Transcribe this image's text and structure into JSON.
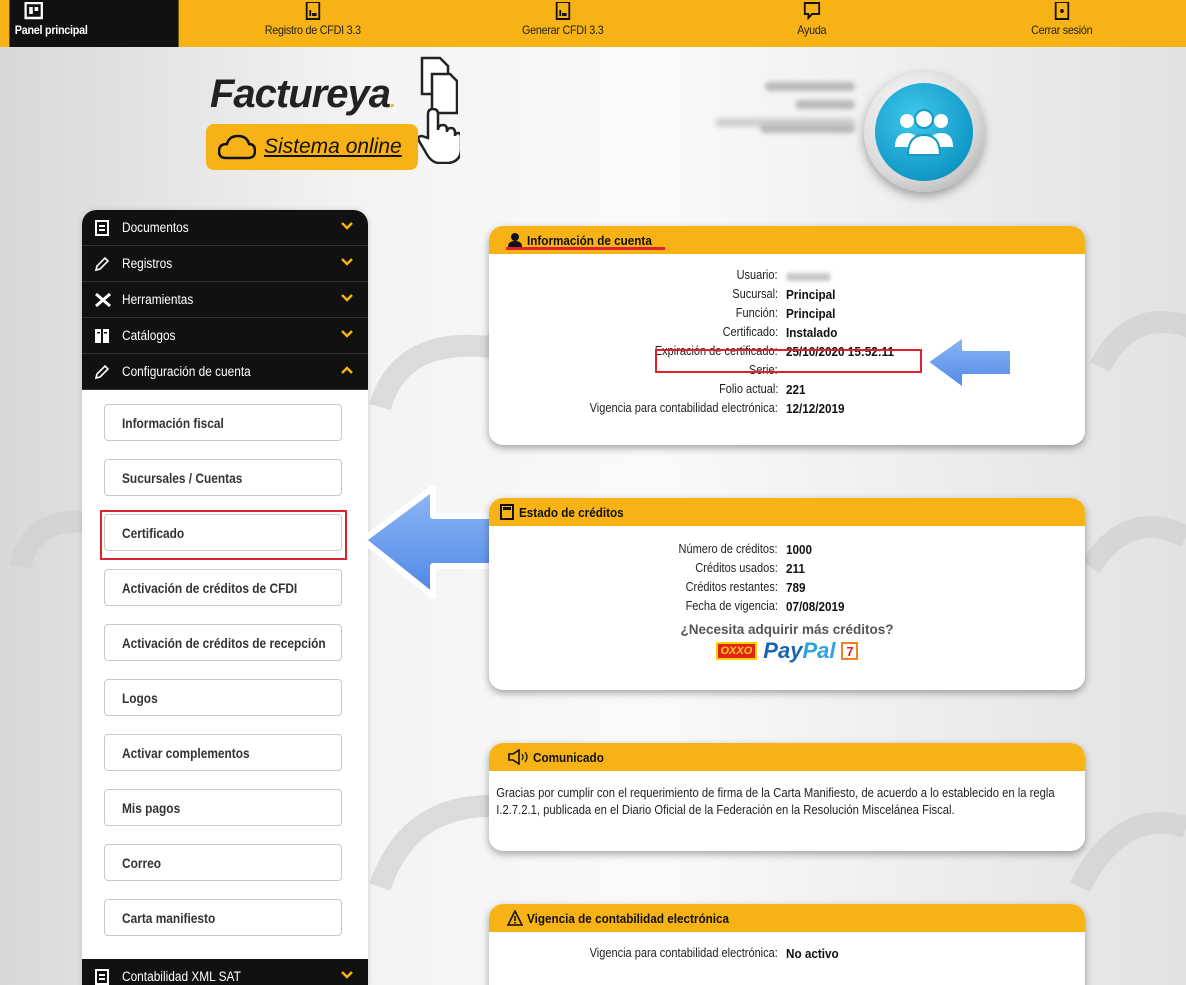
{
  "nav": {
    "items": [
      {
        "label": "Panel principal",
        "icon": "dashboard-icon"
      },
      {
        "label": "Registro de CFDI 3.3",
        "icon": "document-chart-icon"
      },
      {
        "label": "Generar CFDI 3.3",
        "icon": "document-chart-icon"
      },
      {
        "label": "Ayuda",
        "icon": "chat-bubble-icon"
      },
      {
        "label": "Cerrar sesión",
        "icon": "logout-icon"
      }
    ]
  },
  "logo": {
    "brand": "Factureya",
    "dot": ".",
    "tagline": "Sistema online"
  },
  "sidebar": {
    "sections": [
      {
        "label": "Documentos",
        "icon": "document-icon"
      },
      {
        "label": "Registros",
        "icon": "pencil-icon"
      },
      {
        "label": "Herramientas",
        "icon": "tools-icon"
      },
      {
        "label": "Catálogos",
        "icon": "book-icon"
      },
      {
        "label": "Configuración de cuenta",
        "icon": "pencil-icon"
      }
    ],
    "sub_items": [
      "Información fiscal",
      "Sucursales / Cuentas",
      "Certificado",
      "Activación de créditos de CFDI",
      "Activación de créditos de recepción",
      "Logos",
      "Activar complementos",
      "Mis pagos",
      "Correo",
      "Carta manifiesto"
    ],
    "last_section": {
      "label": "Contabilidad XML SAT",
      "icon": "document-icon"
    }
  },
  "account": {
    "title": "Información de cuenta",
    "rows": [
      {
        "k": "Usuario:",
        "v": ""
      },
      {
        "k": "Sucursal:",
        "v": "Principal"
      },
      {
        "k": "Función:",
        "v": "Principal"
      },
      {
        "k": "Certificado:",
        "v": "Instalado"
      },
      {
        "k": "Expiración de certificado:",
        "v": "25/10/2020 15:52:11"
      },
      {
        "k": "Serie:",
        "v": "-"
      },
      {
        "k": "Folio actual:",
        "v": "221"
      },
      {
        "k": "Vigencia para contabilidad electrónica:",
        "v": "12/12/2019"
      }
    ]
  },
  "credits": {
    "title": "Estado de créditos",
    "rows": [
      {
        "k": "Número de créditos:",
        "v": "1000"
      },
      {
        "k": "Créditos usados:",
        "v": "211"
      },
      {
        "k": "Créditos restantes:",
        "v": "789"
      },
      {
        "k": "Fecha de vigencia:",
        "v": "07/08/2019"
      }
    ],
    "need_more": "¿Necesita adquirir más créditos?",
    "oxxo": "OXXO",
    "paypal_a": "Pay",
    "paypal_b": "Pal"
  },
  "notice": {
    "title": "Comunicado",
    "text": "Gracias por cumplir con el requerimiento de firma de la Carta Manifiesto, de acuerdo a lo establecido en la regla I.2.7.2.1, publicada en el Diario Oficial de la Federación en la Resolución Miscelánea Fiscal."
  },
  "accounting": {
    "title": "Vigencia de contabilidad electrónica",
    "row": {
      "k": "Vigencia para contabilidad electrónica:",
      "v": "No activo"
    }
  },
  "colors": {
    "accent": "#f7b315",
    "highlight": "#e0222e",
    "arrow": "#6a9ff0",
    "dark": "#111111"
  }
}
